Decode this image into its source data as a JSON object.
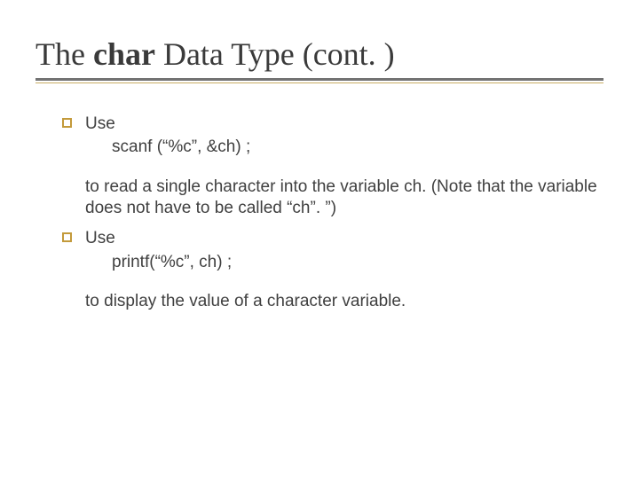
{
  "title": {
    "pre": "The ",
    "bold": "char",
    "post": " Data Type (cont. )"
  },
  "b1": {
    "lead": "Use",
    "code": "scanf (“%c”, &ch) ;",
    "cont": "to read a single character into the variable ch.  (Note that the variable does not have to be called “ch”. ”)"
  },
  "b2": {
    "lead": "Use",
    "code": "printf(“%c”, ch) ;",
    "cont": "to display the value of a character variable."
  }
}
